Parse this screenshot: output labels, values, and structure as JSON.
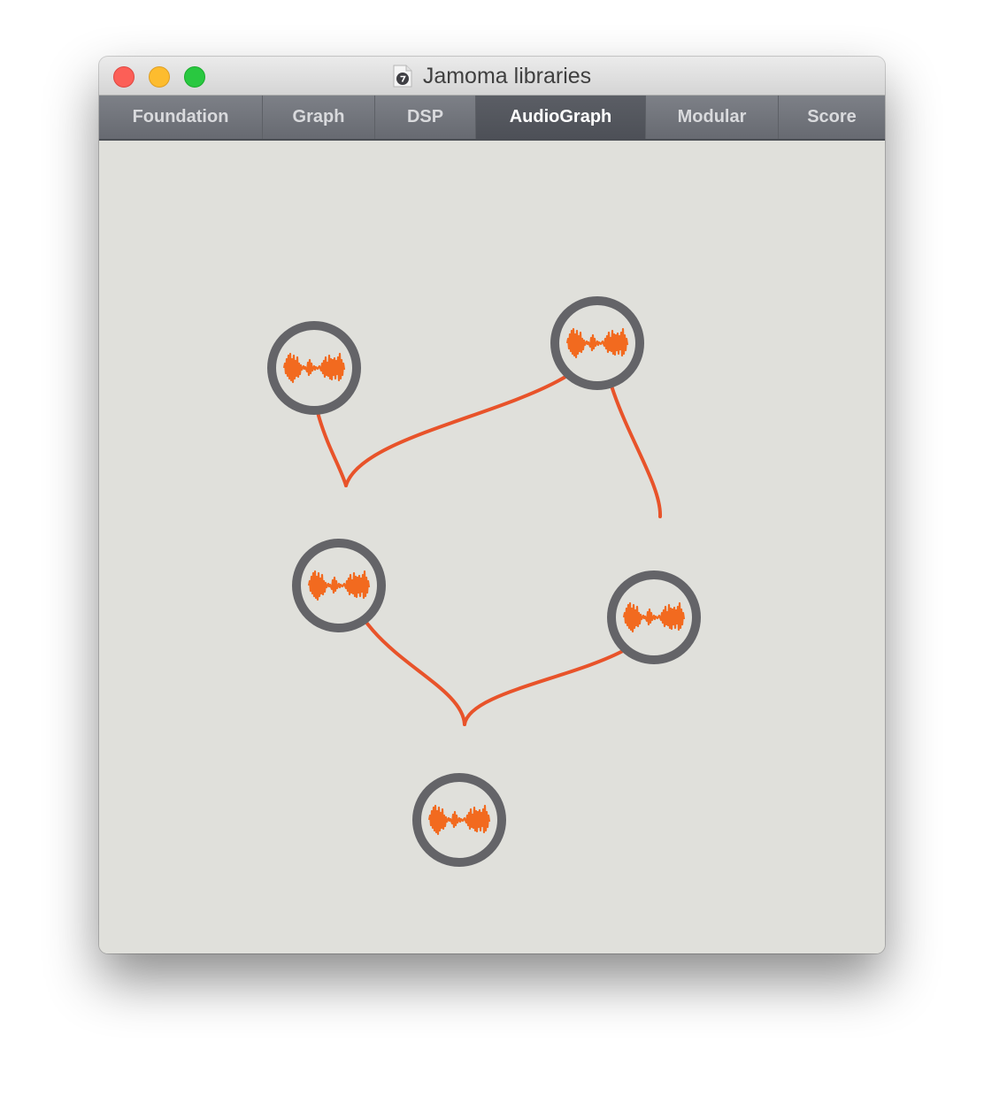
{
  "window": {
    "title": "Jamoma libraries"
  },
  "tabs": [
    {
      "label": "Foundation",
      "active": false
    },
    {
      "label": "Graph",
      "active": false
    },
    {
      "label": "DSP",
      "active": false
    },
    {
      "label": "AudioGraph",
      "active": true
    },
    {
      "label": "Modular",
      "active": false
    },
    {
      "label": "Score",
      "active": false
    }
  ],
  "graph": {
    "nodes": [
      {
        "id": "node-1",
        "icon": "audio-waveform-icon"
      },
      {
        "id": "node-2",
        "icon": "audio-waveform-icon"
      },
      {
        "id": "node-3",
        "icon": "audio-waveform-icon"
      },
      {
        "id": "node-4",
        "icon": "audio-waveform-icon"
      },
      {
        "id": "node-5",
        "icon": "audio-waveform-icon"
      }
    ],
    "connections": [
      {
        "from": "node-1",
        "to": "node-3"
      },
      {
        "from": "node-2",
        "to": "node-3"
      },
      {
        "from": "node-2",
        "to": "node-4"
      },
      {
        "from": "node-3",
        "to": "node-5"
      },
      {
        "from": "node-4",
        "to": "node-5"
      }
    ]
  },
  "colors": {
    "node_ring": "#646468",
    "connection": "#e8532a",
    "waveform": "#f26a1f",
    "canvas_bg": "#e0e0db",
    "tabbar_bg": "#6f7279",
    "active_tab_bg": "#53565d"
  }
}
